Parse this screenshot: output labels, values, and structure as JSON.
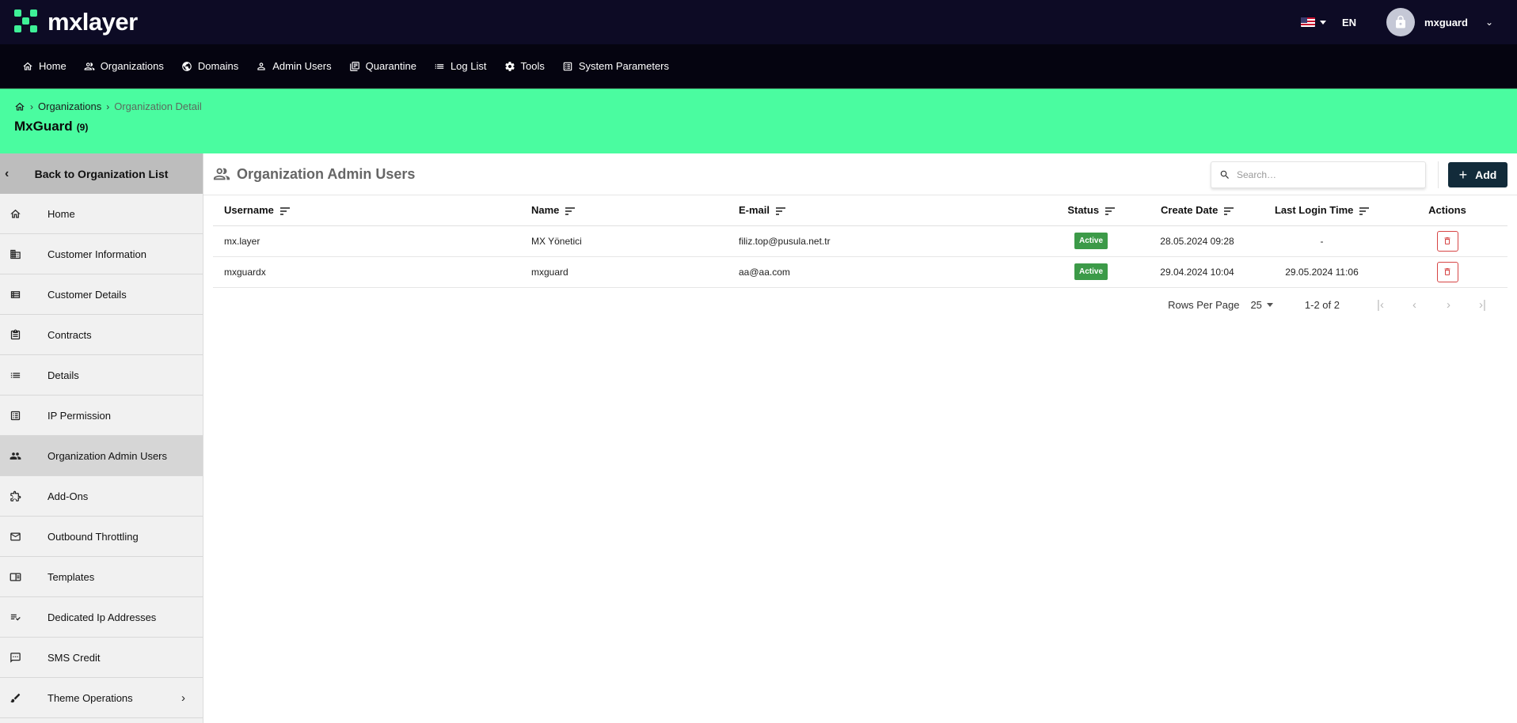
{
  "brand": {
    "name": "mxlayer"
  },
  "topbar": {
    "lang": "EN",
    "user": "mxguard"
  },
  "nav": [
    {
      "label": "Home",
      "icon": "home-icon"
    },
    {
      "label": "Organizations",
      "icon": "people-icon"
    },
    {
      "label": "Domains",
      "icon": "globe-icon"
    },
    {
      "label": "Admin Users",
      "icon": "person-icon"
    },
    {
      "label": "Quarantine",
      "icon": "quarantine-icon"
    },
    {
      "label": "Log List",
      "icon": "list-icon"
    },
    {
      "label": "Tools",
      "icon": "gear-icon"
    },
    {
      "label": "System Parameters",
      "icon": "parameters-icon"
    }
  ],
  "breadcrumb": {
    "items": [
      "Organizations",
      "Organization Detail"
    ]
  },
  "org": {
    "name": "MxGuard",
    "count": "(9)"
  },
  "sidebar": {
    "back_label": "Back to Organization List",
    "items": [
      {
        "label": "Home",
        "icon": "home-icon"
      },
      {
        "label": "Customer Information",
        "icon": "building-icon"
      },
      {
        "label": "Customer Details",
        "icon": "table-icon"
      },
      {
        "label": "Contracts",
        "icon": "document-icon"
      },
      {
        "label": "Details",
        "icon": "list-icon"
      },
      {
        "label": "IP Permission",
        "icon": "ip-list-icon"
      },
      {
        "label": "Organization Admin Users",
        "icon": "people-icon"
      },
      {
        "label": "Add-Ons",
        "icon": "puzzle-icon"
      },
      {
        "label": "Outbound Throttling",
        "icon": "mail-icon"
      },
      {
        "label": "Templates",
        "icon": "template-icon"
      },
      {
        "label": "Dedicated Ip Addresses",
        "icon": "checklist-icon"
      },
      {
        "label": "SMS Credit",
        "icon": "sms-icon"
      },
      {
        "label": "Theme Operations",
        "icon": "brush-icon"
      }
    ],
    "active_index": 6
  },
  "main": {
    "title": "Organization Admin Users",
    "search_placeholder": "Search…",
    "add_label": "Add",
    "columns": {
      "username": "Username",
      "name": "Name",
      "email": "E-mail",
      "status": "Status",
      "create_date": "Create Date",
      "last_login": "Last Login Time",
      "actions": "Actions"
    },
    "rows": [
      {
        "username": "mx.layer",
        "name": "MX Yönetici",
        "email": "filiz.top@pusula.net.tr",
        "status": "Active",
        "create_date": "28.05.2024 09:28",
        "last_login": "-"
      },
      {
        "username": "mxguardx",
        "name": "mxguard",
        "email": "aa@aa.com",
        "status": "Active",
        "create_date": "29.04.2024 10:04",
        "last_login": "29.05.2024 11:06"
      }
    ],
    "pagination": {
      "rows_per_page_label": "Rows Per Page",
      "rows_per_page": "25",
      "range": "1-2 of 2"
    }
  },
  "colors": {
    "brand_green": "#4afca0",
    "topbar": "#0d0b25",
    "status_active": "#3c9a48",
    "delete": "#d64545",
    "add_button": "#122b3a"
  }
}
